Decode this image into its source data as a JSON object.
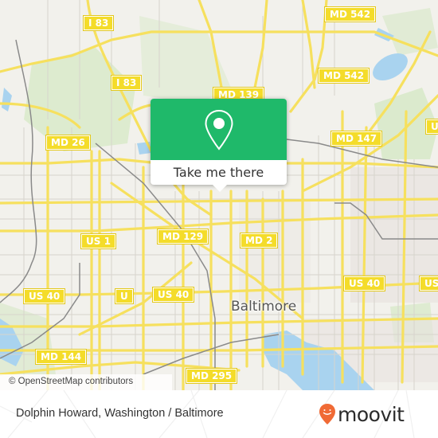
{
  "map": {
    "city_label": "Baltimore",
    "attribution": "© OpenStreetMap contributors",
    "road_shields": [
      {
        "label": "I 83"
      },
      {
        "label": "I 83"
      },
      {
        "label": "MD 542"
      },
      {
        "label": "MD 542"
      },
      {
        "label": "MD 139"
      },
      {
        "label": "MD 26"
      },
      {
        "label": "MD 147"
      },
      {
        "label": "US"
      },
      {
        "label": "MD 129"
      },
      {
        "label": "MD 2"
      },
      {
        "label": "US 1"
      },
      {
        "label": "US 40"
      },
      {
        "label": "US 40"
      },
      {
        "label": "US 40"
      },
      {
        "label": "US"
      },
      {
        "label": "U"
      },
      {
        "label": "MD 144"
      },
      {
        "label": "MD 295"
      }
    ],
    "colors": {
      "land": "#f2f1ec",
      "road": "#f6e05e",
      "water": "#a9d3ef",
      "park": "#d5e8c6",
      "rail": "#888888"
    }
  },
  "popup": {
    "icon": "map-pin-icon",
    "button_label": "Take me there",
    "accent_color": "#1fb96a"
  },
  "footer": {
    "title": "Dolphin Howard, Washington / Baltimore",
    "brand": "moovit",
    "brand_color": "#f06a35"
  }
}
